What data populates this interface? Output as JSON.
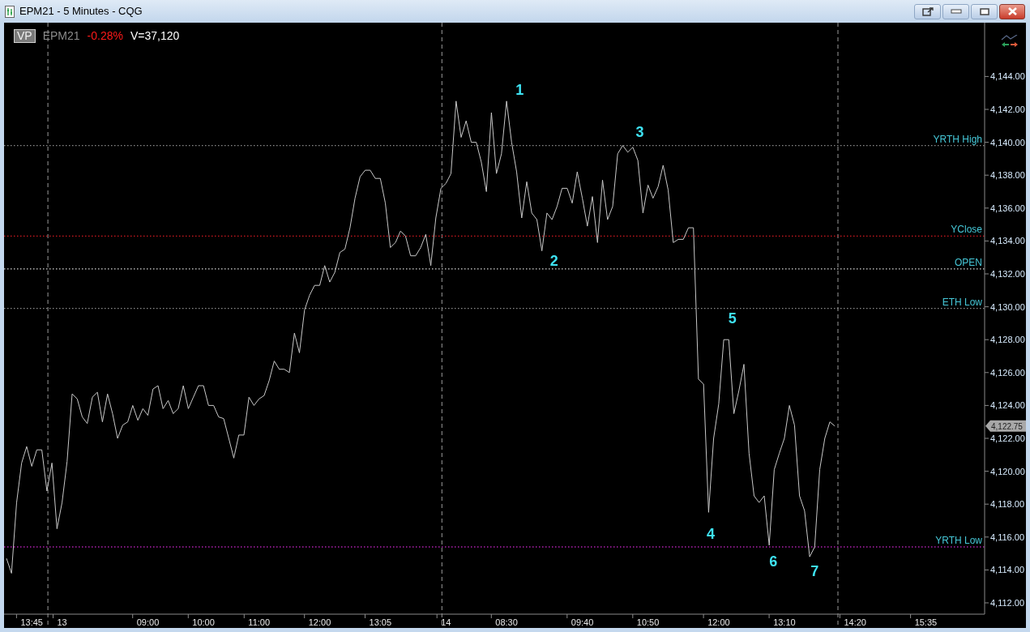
{
  "window": {
    "title": "EPM21 - 5 Minutes - CQG"
  },
  "header": {
    "badge": "VP",
    "symbol": "EPM21",
    "change": "-0.28%",
    "volume": "V=37,120"
  },
  "chart": {
    "price_tag": {
      "label": "4,122.75"
    },
    "chart_data": {
      "type": "line",
      "categories": [
        null,
        null,
        null,
        null,
        null,
        "13:45",
        null,
        null,
        null,
        null,
        null,
        "13",
        null,
        null,
        null,
        null,
        null,
        null,
        null,
        null,
        null,
        null,
        null,
        null,
        null,
        null,
        null,
        null,
        "09:00",
        null,
        null,
        null,
        null,
        null,
        null,
        null,
        null,
        null,
        null,
        "10:00",
        null,
        null,
        null,
        null,
        null,
        null,
        null,
        null,
        null,
        null,
        "11:00",
        null,
        null,
        null,
        null,
        null,
        null,
        null,
        null,
        null,
        null,
        null,
        "12:00",
        null,
        null,
        null,
        null,
        null,
        null,
        null,
        null,
        null,
        null,
        null,
        "13:05",
        null,
        null,
        null,
        null,
        null,
        null,
        null,
        null,
        null,
        null,
        null,
        null,
        "14",
        null,
        null,
        null,
        null,
        null,
        null,
        null,
        null,
        null,
        null,
        null,
        "08:30",
        null,
        null,
        null,
        null,
        null,
        null,
        null,
        null,
        null,
        null,
        null,
        null,
        null,
        null,
        "09:40",
        null,
        null,
        null,
        null,
        null,
        null,
        null,
        null,
        null,
        null,
        null,
        null,
        "10:50",
        null,
        null,
        null,
        null,
        null,
        null,
        null,
        null,
        null,
        null,
        null,
        null,
        null,
        "12:00",
        null,
        null,
        null,
        null,
        null,
        null,
        null,
        null,
        null,
        null,
        null,
        null,
        "13:10",
        null,
        null,
        null,
        null,
        null,
        null,
        null,
        null,
        null,
        null,
        null,
        null,
        null,
        "14:20",
        null,
        null,
        null,
        null,
        null,
        null,
        null,
        null,
        null,
        null,
        null,
        null,
        null,
        "15:35",
        null,
        null,
        null,
        null,
        null,
        null,
        null,
        null,
        null,
        null,
        null
      ],
      "series": [
        {
          "color": "#c8c8c8",
          "values": [
            4114.7,
            4113.8,
            4118.1,
            4120.5,
            4121.5,
            4120.3,
            4121.3,
            4121.3,
            4118.8,
            4120.5,
            4116.5,
            4118.1,
            4120.6,
            4124.7,
            4124.4,
            4123.3,
            4122.9,
            4124.5,
            4124.8,
            4123.0,
            4124.7,
            4123.5,
            4122.0,
            4122.8,
            4123.0,
            4124.0,
            4123.1,
            4123.8,
            4123.4,
            4125.0,
            4125.2,
            4123.8,
            4124.3,
            4123.5,
            4123.8,
            4125.2,
            4123.8,
            4124.5,
            4125.2,
            4125.2,
            4124.0,
            4124.0,
            4123.3,
            4123.2,
            4122.0,
            4120.8,
            4122.2,
            4122.2,
            4124.5,
            4124.0,
            4124.4,
            4124.6,
            4125.5,
            4126.7,
            4126.2,
            4126.2,
            4126.0,
            4128.4,
            4127.2,
            4129.8,
            4130.7,
            4131.3,
            4131.3,
            4132.5,
            4131.5,
            4132.1,
            4133.3,
            4133.5,
            4134.8,
            4136.6,
            4137.9,
            4138.3,
            4138.3,
            4137.8,
            4137.8,
            4136.3,
            4133.6,
            4133.9,
            4134.6,
            4134.3,
            4133.1,
            4133.1,
            4133.6,
            4134.4,
            4132.5,
            4135.4,
            4137.2,
            4137.5,
            4138.1,
            4142.5,
            4140.3,
            4141.3,
            4140.0,
            4140.0,
            4138.8,
            4137.0,
            4141.8,
            4138.1,
            4139.3,
            4142.5,
            4140.0,
            4138.2,
            4135.4,
            4137.6,
            4135.7,
            4135.3,
            4133.4,
            4135.7,
            4135.3,
            4136.1,
            4137.2,
            4137.2,
            4136.3,
            4138.2,
            4136.6,
            4134.9,
            4136.7,
            4133.9,
            4137.7,
            4135.3,
            4136.1,
            4139.3,
            4139.8,
            4139.4,
            4139.7,
            4138.9,
            4135.7,
            4137.4,
            4136.6,
            4137.3,
            4138.6,
            4137.1,
            4133.9,
            4134.1,
            4134.1,
            4134.8,
            4134.8,
            4125.6,
            4125.3,
            4117.5,
            4122.0,
            4124.1,
            4128.0,
            4128.0,
            4123.5,
            4124.9,
            4126.5,
            4121.1,
            4118.5,
            4118.1,
            4118.5,
            4115.5,
            4120.1,
            4121.1,
            4122.0,
            4124.0,
            4122.8,
            4118.5,
            4117.6,
            4114.8,
            4115.4,
            4120.1,
            4122.0,
            4123.0,
            4122.75,
            null,
            null,
            null,
            null,
            null,
            null,
            null,
            null,
            null,
            null,
            null,
            null,
            null,
            null,
            null,
            null,
            null,
            null,
            null,
            null,
            null,
            null,
            null,
            null,
            null,
            null,
            null,
            null,
            null
          ]
        }
      ],
      "ylim": [
        4111.31,
        4147.27
      ],
      "yticks": [
        {
          "value": 4144,
          "label": "4,144.00"
        },
        {
          "value": 4142,
          "label": "4,142.00"
        },
        {
          "value": 4140,
          "label": "4,140.00"
        },
        {
          "value": 4138,
          "label": "4,138.00"
        },
        {
          "value": 4136,
          "label": "4,136.00"
        },
        {
          "value": 4134,
          "label": "4,134.00"
        },
        {
          "value": 4132,
          "label": "4,132.00"
        },
        {
          "value": 4130,
          "label": "4,130.00"
        },
        {
          "value": 4128,
          "label": "4,128.00"
        },
        {
          "value": 4126,
          "label": "4,126.00"
        },
        {
          "value": 4124,
          "label": "4,124.00"
        },
        {
          "value": 4122,
          "label": "4,122.00"
        },
        {
          "value": 4120,
          "label": "4,120.00"
        },
        {
          "value": 4118,
          "label": "4,118.00"
        },
        {
          "value": 4116,
          "label": "4,116.00"
        },
        {
          "value": 4114,
          "label": "4,114.00"
        },
        {
          "value": 4112,
          "label": "4,112.00"
        }
      ],
      "ref_lines": [
        {
          "axis": "y",
          "value": 4139.8,
          "label": "YRTH High",
          "color": "#8a8a8a"
        },
        {
          "axis": "y",
          "value": 4134.3,
          "label": "YClose",
          "color": "#d01820"
        },
        {
          "axis": "y",
          "value": 4132.3,
          "label": "OPEN",
          "color": "#d8d8d8"
        },
        {
          "axis": "y",
          "value": 4129.9,
          "label": "ETH Low",
          "color": "#8a8a8a"
        },
        {
          "axis": "y",
          "value": 4115.4,
          "label": "YRTH Low",
          "color": "#b020b0"
        }
      ],
      "annotations": [
        "1",
        "2",
        "3",
        "4",
        "5",
        "6",
        "7"
      ]
    }
  }
}
